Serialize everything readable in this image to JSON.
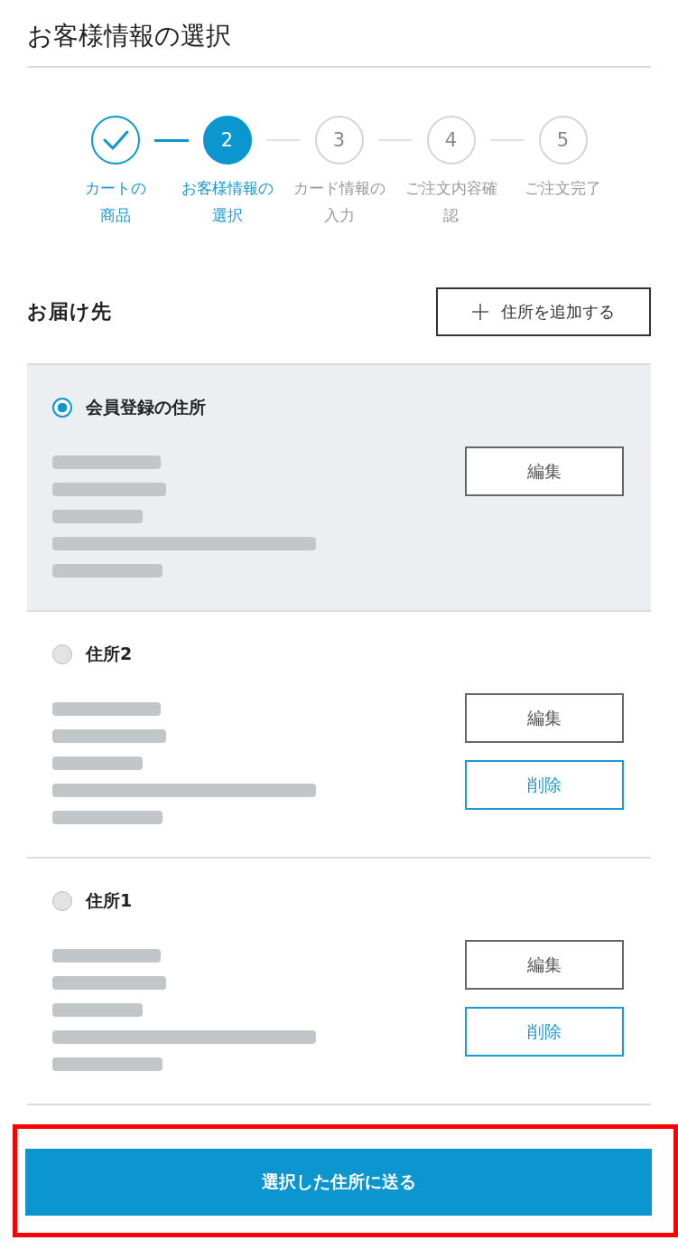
{
  "page": {
    "title": "お客様情報の選択"
  },
  "steps": [
    {
      "label_lines": [
        "カートの",
        "商品"
      ],
      "completed": true,
      "current": false
    },
    {
      "number": "2",
      "label_lines": [
        "お客様情報の",
        "選択"
      ],
      "completed": false,
      "current": true
    },
    {
      "number": "3",
      "label_lines": [
        "カード情報の",
        "入力"
      ],
      "completed": false,
      "current": false
    },
    {
      "number": "4",
      "label_lines": [
        "ご注文内容確",
        "認"
      ],
      "completed": false,
      "current": false
    },
    {
      "number": "5",
      "label_lines": [
        "ご注文完了"
      ],
      "completed": false,
      "current": false
    }
  ],
  "delivery": {
    "heading": "お届け先",
    "add_button": {
      "label": "住所を追加する"
    }
  },
  "addresses": [
    {
      "title": "会員登録の住所",
      "selected": true,
      "details_blurred": true,
      "actions": [
        {
          "kind": "edit",
          "label": "編集"
        }
      ]
    },
    {
      "title": "住所2",
      "selected": false,
      "details_blurred": true,
      "actions": [
        {
          "kind": "edit",
          "label": "編集"
        },
        {
          "kind": "delete",
          "label": "削除"
        }
      ]
    },
    {
      "title": "住所1",
      "selected": false,
      "details_blurred": true,
      "actions": [
        {
          "kind": "edit",
          "label": "編集"
        },
        {
          "kind": "delete",
          "label": "削除"
        }
      ]
    }
  ],
  "submit": {
    "label": "選択した住所に送る",
    "highlighted": true
  }
}
